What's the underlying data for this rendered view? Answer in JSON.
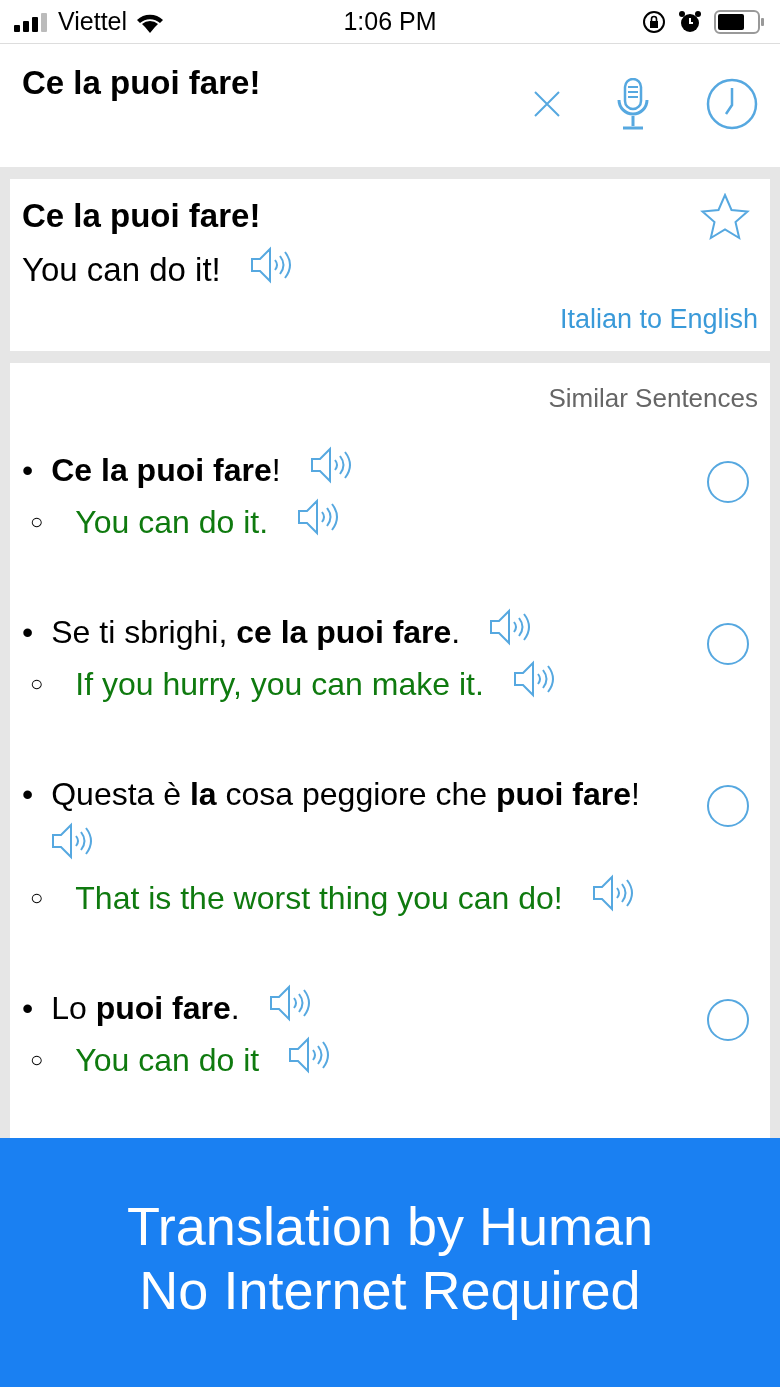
{
  "status_bar": {
    "carrier": "Viettel",
    "time": "1:06 PM"
  },
  "search": {
    "value": "Ce la puoi fare!"
  },
  "result": {
    "source": "Ce la puoi fare!",
    "translation": "You can do it!",
    "starred": false,
    "direction": "Italian to English"
  },
  "similar": {
    "title": "Similar Sentences",
    "items": [
      {
        "bullet": "•",
        "text": "**Ce la puoi fare**!",
        "sub_bullet": "○",
        "translation": "You can do it.",
        "selected": false
      },
      {
        "bullet": "•",
        "text": "Se ti sbrighi, **ce la puoi fare**.",
        "sub_bullet": "○",
        "translation": "If you hurry, you can make it.",
        "selected": false
      },
      {
        "bullet": "•",
        "text": "Questa è **la** cosa peggiore che **puoi fare**!",
        "sub_bullet": "○",
        "translation": "That is the worst thing you can do!",
        "selected": false
      },
      {
        "bullet": "•",
        "text": "Lo **puoi fare**.",
        "sub_bullet": "○",
        "translation": "You can do it",
        "selected": false
      }
    ]
  },
  "banner": {
    "lines": [
      "Translation by Human",
      "No Internet Required"
    ]
  }
}
